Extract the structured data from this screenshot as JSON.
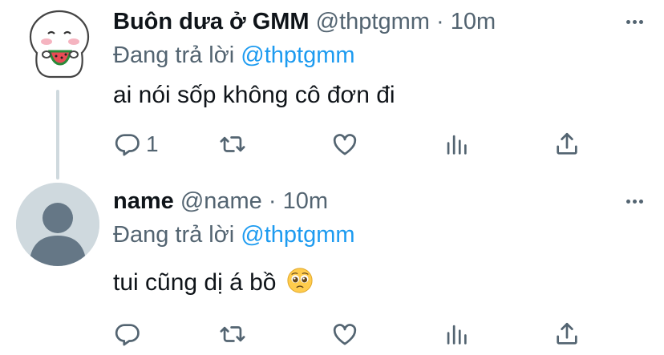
{
  "tweets": [
    {
      "author_name": "Buôn dưa ở GMM",
      "handle": "@thptgmm",
      "time": "10m",
      "reply_prefix": "Đang trả lời",
      "reply_mention": "@thptgmm",
      "text": "ai nói sốp không cô đơn đi",
      "reply_count": "1",
      "avatar": "cute-cat-sticker"
    },
    {
      "author_name": "name",
      "handle": "@name",
      "time": "10m",
      "reply_prefix": "Đang trả lời",
      "reply_mention": "@thptgmm",
      "text": "tui cũng dị á bồ",
      "emoji": "pleading-face",
      "reply_count": "",
      "avatar": "default-avatar"
    }
  ],
  "separator": "·",
  "icons": {
    "reply": "reply-icon",
    "retweet": "retweet-icon",
    "like": "like-icon",
    "views": "views-icon",
    "share": "share-icon",
    "more": "more-icon"
  },
  "colors": {
    "text": "#0f1419",
    "secondary": "#536471",
    "accent": "#1d9bf0",
    "avatar_bg": "#cfd9de"
  }
}
